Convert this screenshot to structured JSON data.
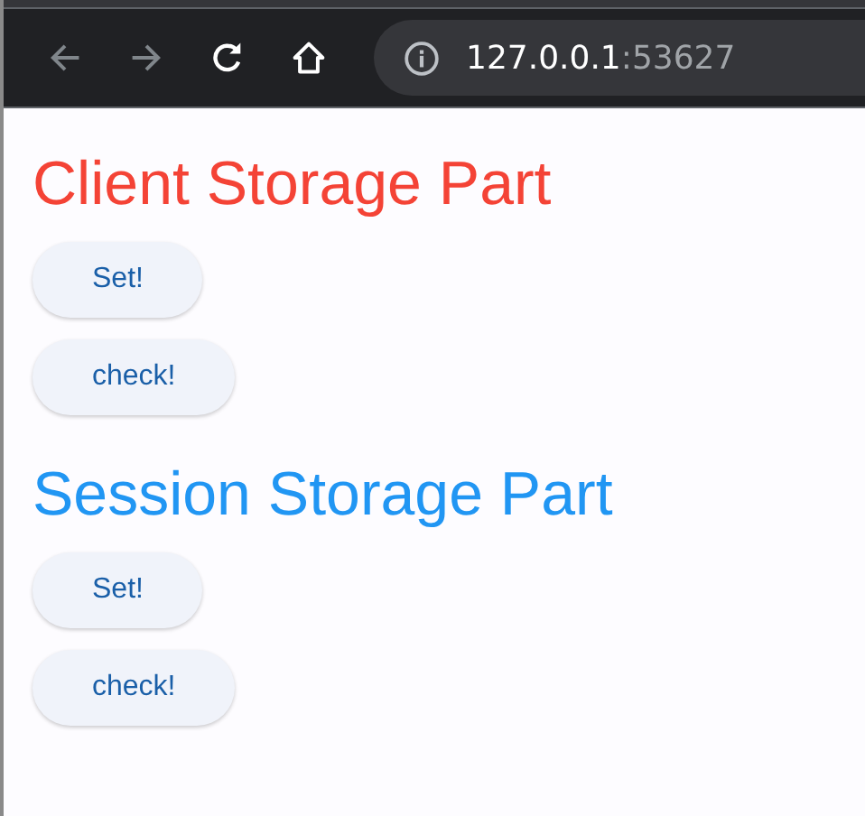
{
  "browser": {
    "url_host": "127.0.0.1",
    "url_port": ":53627"
  },
  "sections": [
    {
      "title": "Client Storage Part",
      "color": "#f44336",
      "buttons": [
        "Set!",
        "check!"
      ]
    },
    {
      "title": "Session Storage Part",
      "color": "#2196f3",
      "buttons": [
        "Set!",
        "check!"
      ]
    }
  ]
}
